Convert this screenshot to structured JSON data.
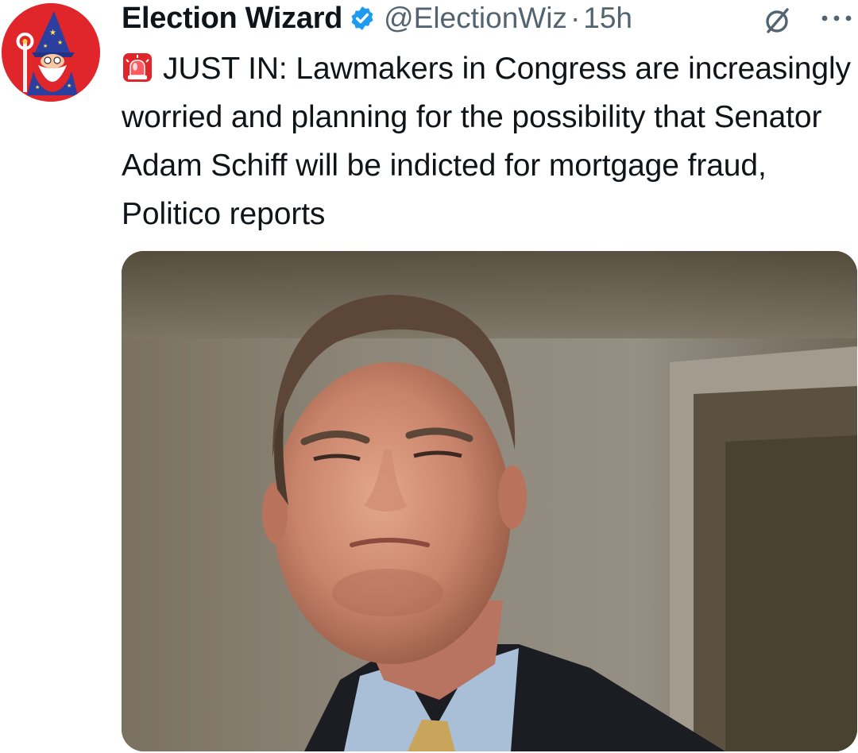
{
  "tweet": {
    "author": {
      "display_name": "Election Wizard",
      "handle": "@ElectionWiz",
      "verified": true,
      "avatar_icon": "wizard-avatar-icon"
    },
    "separator": "·",
    "time": "15h",
    "text": {
      "emoji_icon": "rotating-light-icon",
      "body": "JUST IN: Lawmakers in Congress are increasingly worried and planning for the possibility that Senator Adam Schiff will be indicted for mortgage fraud, Politico reports"
    },
    "media": {
      "type": "photo"
    },
    "icons": {
      "grok": "grok-icon",
      "more": "more-options-icon",
      "verified": "verified-badge-icon"
    },
    "colors": {
      "avatar_bg": "#e0262b",
      "verified_blue": "#1d9bf0",
      "secondary_text": "#536471",
      "primary_text": "#0f1419"
    }
  }
}
